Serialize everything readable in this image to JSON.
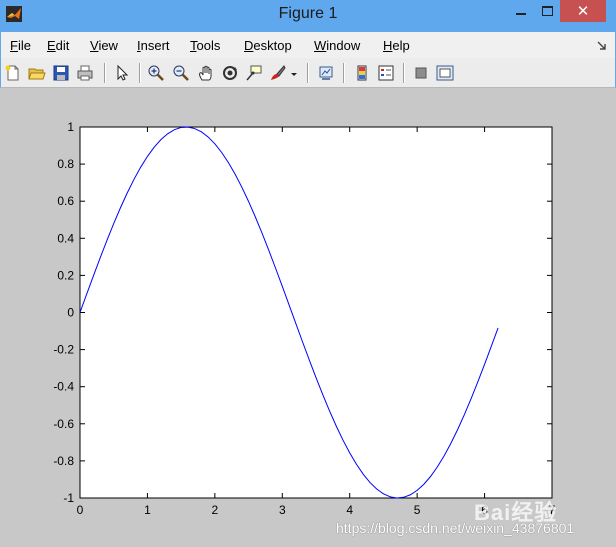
{
  "window": {
    "title": "Figure 1",
    "close_glyph": "✕",
    "accent_color": "#5fa8ee",
    "close_color": "#c75050"
  },
  "menu": {
    "items": [
      {
        "key": "F",
        "rest": "ile"
      },
      {
        "key": "E",
        "rest": "dit"
      },
      {
        "key": "V",
        "rest": "iew"
      },
      {
        "key": "I",
        "rest": "nsert"
      },
      {
        "key": "T",
        "rest": "ools"
      },
      {
        "key": "D",
        "rest": "esktop"
      },
      {
        "key": "W",
        "rest": "indow"
      },
      {
        "key": "H",
        "rest": "elp"
      }
    ]
  },
  "toolbar": {
    "icons": [
      "new-figure-icon",
      "open-file-icon",
      "save-icon",
      "print-icon",
      "edit-plot-arrow-icon",
      "zoom-in-icon",
      "zoom-out-icon",
      "pan-hand-icon",
      "rotate-3d-icon",
      "data-cursor-icon",
      "brush-icon",
      "brush-dropdown-icon",
      "link-plot-icon",
      "colorbar-icon",
      "legend-icon",
      "hide-plot-tools-icon",
      "show-plot-tools-icon"
    ]
  },
  "watermark": {
    "text": "https://blog.csdn.net/weixin_43876801",
    "logo_text": "Bai经验"
  },
  "chart_data": {
    "type": "line",
    "title": "",
    "xlabel": "",
    "ylabel": "",
    "xlim": [
      0,
      7
    ],
    "ylim": [
      -1,
      1
    ],
    "x_ticks": [
      "0",
      "1",
      "2",
      "3",
      "4",
      "5",
      "6",
      "7"
    ],
    "y_ticks": [
      "-1",
      "-0.8",
      "-0.6",
      "-0.4",
      "-0.2",
      "0",
      "0.2",
      "0.4",
      "0.6",
      "0.8",
      "1"
    ],
    "grid": false,
    "series": [
      {
        "color": "#0000ff",
        "x_start": 0,
        "x_end": 6.2832,
        "x_step": 0.1,
        "function": "sin(x)"
      }
    ]
  }
}
